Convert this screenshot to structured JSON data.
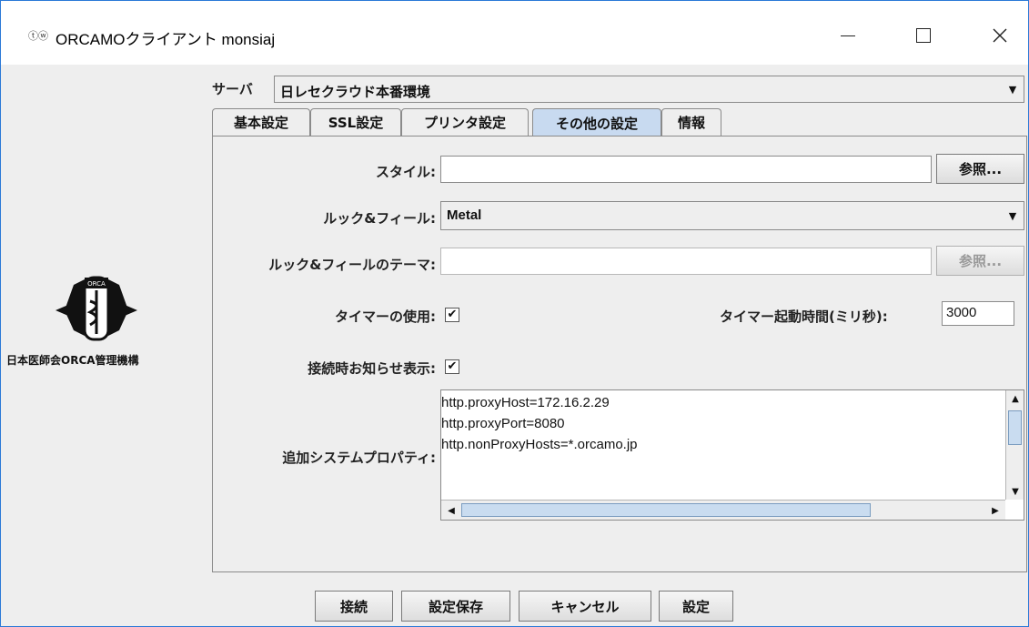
{
  "window": {
    "title": "ORCAMOクライアント monsiaj",
    "app_icon_glyph": "ⓣⓦ"
  },
  "branding": {
    "logo_text": "ORCA",
    "org_name": "日本医師会ORCA管理機構"
  },
  "server": {
    "label": "サーバ",
    "value": "日レセクラウド本番環境"
  },
  "tabs": [
    {
      "label": "基本設定",
      "active": false
    },
    {
      "label": "SSL設定",
      "active": false
    },
    {
      "label": "プリンタ設定",
      "active": false
    },
    {
      "label": "その他の設定",
      "active": true
    },
    {
      "label": "情報",
      "active": false
    }
  ],
  "settings": {
    "style_label": "スタイル:",
    "style_value": "",
    "browse_label": "参照...",
    "lookfeel_label": "ルック&フィール:",
    "lookfeel_value": "Metal",
    "theme_label": "ルック&フィールのテーマ:",
    "theme_value": "",
    "theme_browse_label": "参照...",
    "timer_label": "タイマーの使用:",
    "timer_checked": "✔",
    "timer_interval_label": "タイマー起動時間(ミリ秒):",
    "timer_interval_value": "3000",
    "notice_label": "接続時お知らせ表示:",
    "notice_checked": "✔",
    "props_label": "追加システムプロパティ:",
    "props_lines": [
      "http.proxyHost=172.16.2.29",
      "http.proxyPort=8080",
      "http.nonProxyHosts=*.orcamo.jp"
    ]
  },
  "footer": {
    "connect": "接続",
    "save": "設定保存",
    "cancel": "キャンセル",
    "settings": "設定"
  }
}
